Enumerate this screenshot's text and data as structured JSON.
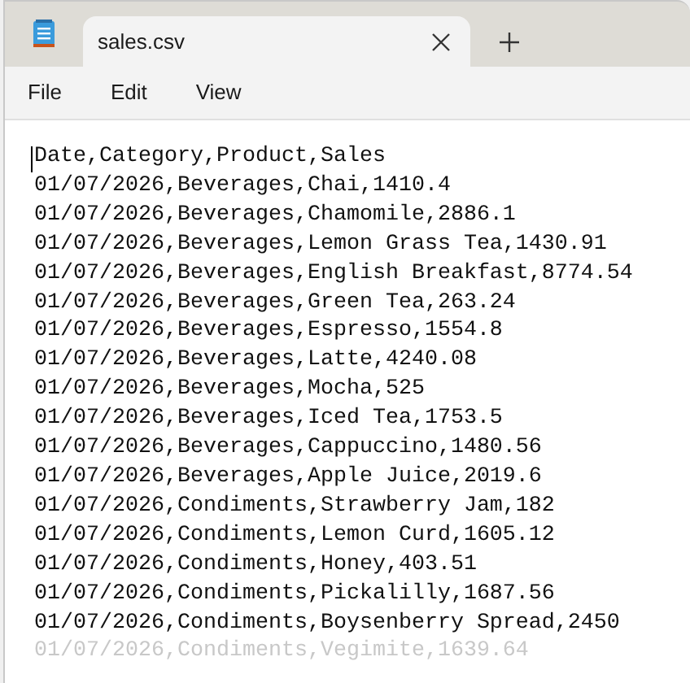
{
  "tab": {
    "title": "sales.csv",
    "selected": true
  },
  "menu": [
    "File",
    "Edit",
    "View"
  ],
  "lines": [
    "Date,Category,Product,Sales",
    "01/07/2026,Beverages,Chai,1410.4",
    "01/07/2026,Beverages,Chamomile,2886.1",
    "01/07/2026,Beverages,Lemon Grass Tea,1430.91",
    "01/07/2026,Beverages,English Breakfast,8774.54",
    "01/07/2026,Beverages,Green Tea,263.24",
    "01/07/2026,Beverages,Espresso,1554.8",
    "01/07/2026,Beverages,Latte,4240.08",
    "01/07/2026,Beverages,Mocha,525",
    "01/07/2026,Beverages,Iced Tea,1753.5",
    "01/07/2026,Beverages,Cappuccino,1480.56",
    "01/07/2026,Beverages,Apple Juice,2019.6",
    "01/07/2026,Condiments,Strawberry Jam,182",
    "01/07/2026,Condiments,Lemon Curd,1605.12",
    "01/07/2026,Condiments,Honey,403.51",
    "01/07/2026,Condiments,Pickalilly,1687.56",
    "01/07/2026,Condiments,Boysenberry Spread,2450",
    "01/07/2026,Condiments,Vegimite,1639.64"
  ]
}
